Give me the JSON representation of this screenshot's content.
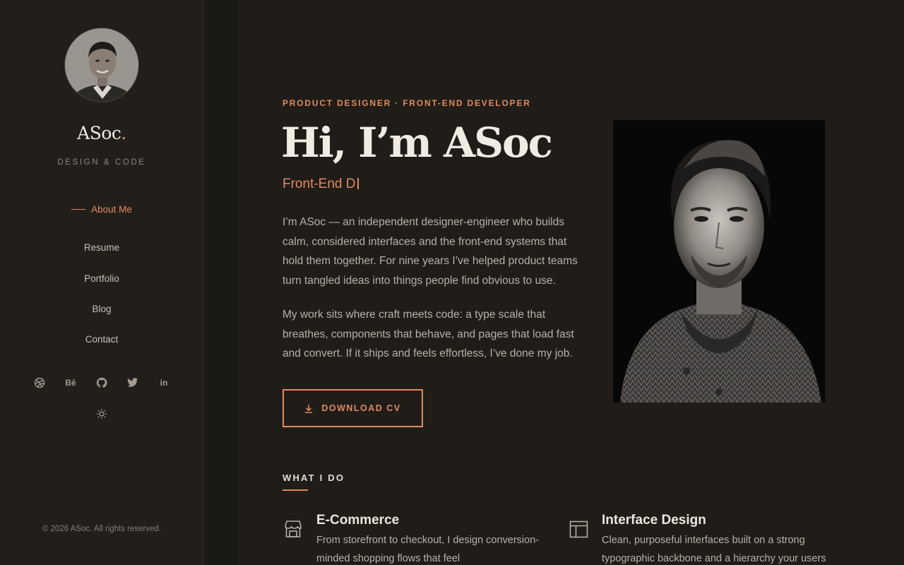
{
  "sidebar": {
    "brand": "ASoc",
    "brand_dot": ".",
    "tagline": "DESIGN & CODE",
    "nav": [
      {
        "label": "About Me",
        "active": true
      },
      {
        "label": "Resume",
        "active": false
      },
      {
        "label": "Portfolio",
        "active": false
      },
      {
        "label": "Blog",
        "active": false
      },
      {
        "label": "Contact",
        "active": false
      }
    ],
    "socials": [
      {
        "icon": "dribbble-icon",
        "glyph": ""
      },
      {
        "icon": "behance-icon",
        "glyph": "Bē"
      },
      {
        "icon": "github-icon",
        "glyph": ""
      },
      {
        "icon": "twitter-icon",
        "glyph": ""
      },
      {
        "icon": "linkedin-icon",
        "glyph": "in"
      }
    ],
    "theme_icon": "sun-icon",
    "copyright": "© 2026 ASoc. All rights reserved."
  },
  "hero": {
    "eyebrow": "PRODUCT DESIGNER · FRONT-END DEVELOPER",
    "title": "Hi, I’m ASoc",
    "typed": "Front-End D",
    "paragraphs": [
      "I’m ASoc — an independent designer-engineer who builds calm, considered interfaces and the front-end systems that hold them together. For nine years I’ve helped product teams turn tangled ideas into things people find obvious to use.",
      "My work sits where craft meets code: a type scale that breathes, components that behave, and pages that load fast and convert. If it ships and feels effortless, I’ve done my job."
    ],
    "cv_button": "DOWNLOAD CV",
    "cv_icon": "download-icon"
  },
  "services": {
    "heading": "WHAT I DO",
    "items": [
      {
        "icon": "storefront-icon",
        "title": "E-Commerce",
        "desc": "From storefront to checkout, I design conversion-minded shopping flows that feel"
      },
      {
        "icon": "layout-icon",
        "title": "Interface Design",
        "desc": "Clean, purposeful interfaces built on a strong typographic backbone and a hierarchy your users"
      }
    ]
  },
  "colors": {
    "accent": "#e08a5e",
    "background": "#201d19",
    "sidebar": "#221f1b"
  }
}
